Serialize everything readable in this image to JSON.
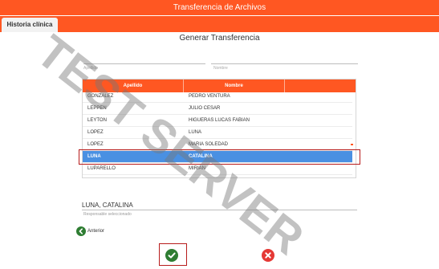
{
  "header": {
    "title": "Transferencia de Archivos"
  },
  "tabs": [
    {
      "label": "Historia clínica"
    }
  ],
  "page": {
    "title": "Generar Transferencia"
  },
  "search": {
    "apellido_label": "Apellido",
    "nombre_label": "Nombre"
  },
  "table": {
    "columns": [
      "Apellido",
      "Nombre"
    ],
    "rows": [
      {
        "apellido": "GONZALEZ",
        "nombre": "PEDRO VENTURA"
      },
      {
        "apellido": "LEPPEN",
        "nombre": "JULIO CESAR"
      },
      {
        "apellido": "LEYTON",
        "nombre": "HIGUERAS LUCAS FABIAN"
      },
      {
        "apellido": "LOPEZ",
        "nombre": "LUNA"
      },
      {
        "apellido": "LOPEZ",
        "nombre": "MARIA SOLEDAD"
      },
      {
        "apellido": "LUNA",
        "nombre": "CATALINA"
      },
      {
        "apellido": "LUPARELLO",
        "nombre": "MIRIAN"
      }
    ],
    "selected_index": 5
  },
  "responsable": {
    "value": "LUNA, CATALINA",
    "label": "Responsable seleccionado"
  },
  "nav": {
    "back_label": "Anterior"
  },
  "watermark": {
    "text": "TEST SERVER"
  },
  "colors": {
    "accent": "#ff5722",
    "selection": "#4a90e2",
    "ok": "#2e7d32",
    "cancel": "#e53935"
  },
  "icons": {
    "back": "arrow-left-circle-icon",
    "ok": "check-circle-icon",
    "cancel": "x-circle-icon"
  }
}
